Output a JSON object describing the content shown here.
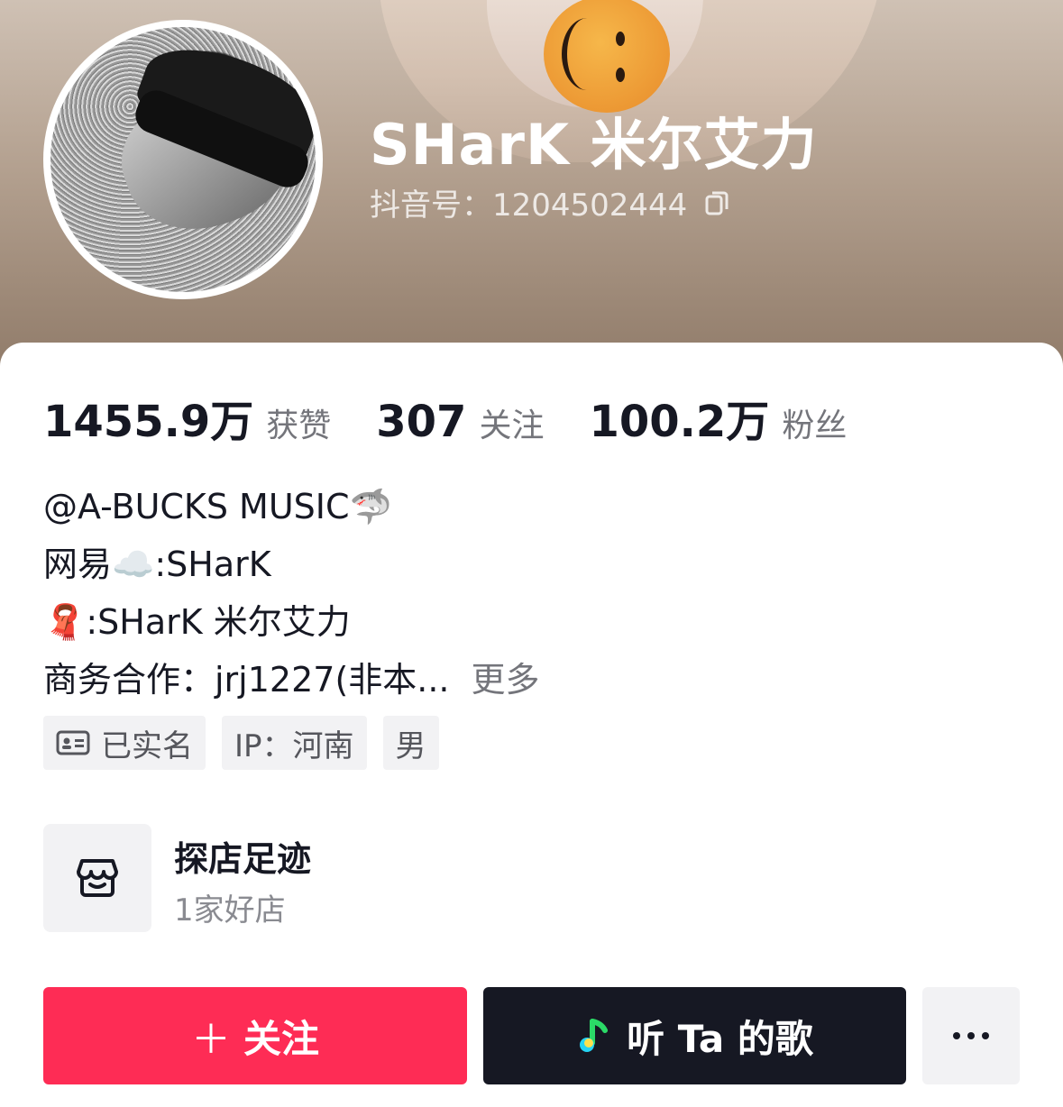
{
  "profile": {
    "name": "SHarK 米尔艾力",
    "douyin_id": "抖音号：1204502444"
  },
  "stats": [
    {
      "value": "1455.9万",
      "label": "获赞"
    },
    {
      "value": "307",
      "label": "关注"
    },
    {
      "value": "100.2万",
      "label": "粉丝"
    }
  ],
  "bio": {
    "line1": "@A-BUCKS MUSIC",
    "line1_emoji": "🦈",
    "line2_prefix": "网易",
    "line2_emoji": "☁️",
    "line2_suffix": ":SHarK",
    "line3_emoji": "🧣",
    "line3_text": ":SHarK 米尔艾力",
    "line4_text": "商务合作：jrj1227(非本...",
    "more_label": "更多"
  },
  "tags": {
    "verified": "已实名",
    "ip": "IP：河南",
    "gender": "男"
  },
  "store": {
    "title": "探店足迹",
    "subtitle": "1家好店",
    "icon": "store-icon"
  },
  "buttons": {
    "follow_label": "关注",
    "follow_icon": "plus-icon",
    "music_label": "听 Ta 的歌",
    "music_icon": "music-note-icon",
    "more_icon": "more-dots-icon"
  },
  "colors": {
    "follow_button": "#fe2c55",
    "music_button": "#161823",
    "secondary_text": "#74757b",
    "tag_background": "#f2f2f4"
  }
}
